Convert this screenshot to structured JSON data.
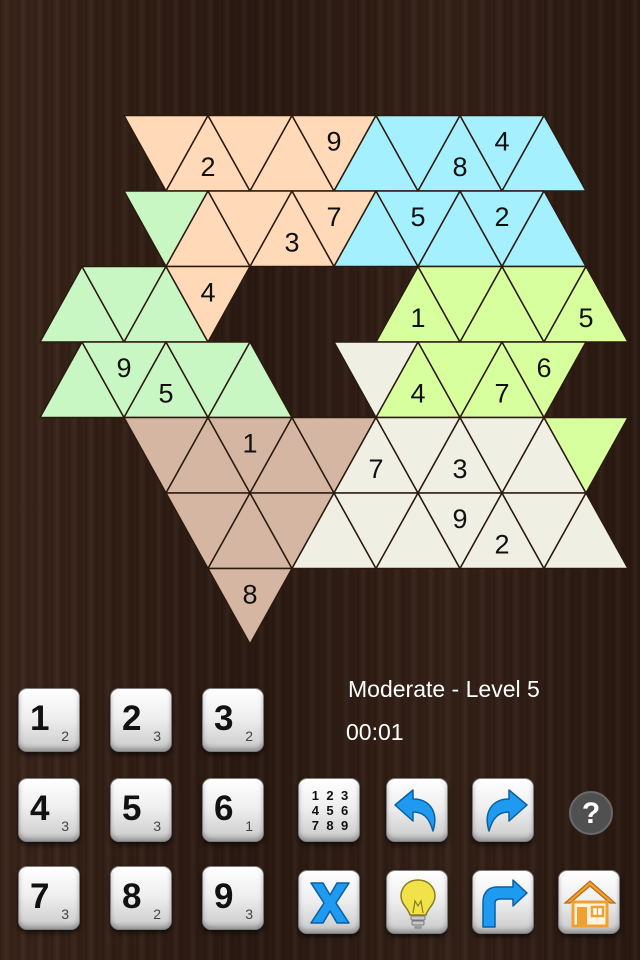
{
  "puzzle": {
    "clues": [
      {
        "row": 1,
        "col": 0,
        "value": "2"
      },
      {
        "row": 1,
        "col": 4,
        "value": "9"
      },
      {
        "row": 1,
        "col": 7,
        "value": "8"
      },
      {
        "row": 1,
        "col": 8,
        "value": "4"
      },
      {
        "row": 2,
        "col": 3,
        "value": "3"
      },
      {
        "row": 2,
        "col": 4,
        "value": "7"
      },
      {
        "row": 2,
        "col": 6,
        "value": "5"
      },
      {
        "row": 2,
        "col": 8,
        "value": "2"
      },
      {
        "row": 3,
        "col": 3,
        "value": "4"
      },
      {
        "row": 3,
        "col": 8,
        "value": "1"
      },
      {
        "row": 3,
        "col": 12,
        "value": "5"
      },
      {
        "row": 4,
        "col": 1,
        "value": "9"
      },
      {
        "row": 4,
        "col": 2,
        "value": "5"
      },
      {
        "row": 4,
        "col": 8,
        "value": "4"
      },
      {
        "row": 4,
        "col": 10,
        "value": "7"
      },
      {
        "row": 4,
        "col": 11,
        "value": "6"
      },
      {
        "row": 5,
        "col": 3,
        "value": "1"
      },
      {
        "row": 5,
        "col": 6,
        "value": "7"
      },
      {
        "row": 5,
        "col": 8,
        "value": "3"
      },
      {
        "row": 6,
        "col": 8,
        "value": "9"
      },
      {
        "row": 6,
        "col": 9,
        "value": "2"
      },
      {
        "row": 7,
        "col": 2,
        "value": "8"
      }
    ],
    "region_colors": {
      "orange": "#ffd9b8",
      "blue": "#a5f0ff",
      "green": "#c9f7c3",
      "lime": "#d8ff9e",
      "brown": "#d4b6a3",
      "cream": "#efefe4"
    },
    "line_color": "#2a1a0e"
  },
  "status": {
    "difficulty": "Moderate - Level 5",
    "timer": "00:01"
  },
  "keypad": [
    {
      "digit": "1",
      "count": "2"
    },
    {
      "digit": "2",
      "count": "3"
    },
    {
      "digit": "3",
      "count": "2"
    },
    {
      "digit": "4",
      "count": "3"
    },
    {
      "digit": "5",
      "count": "3"
    },
    {
      "digit": "6",
      "count": "1"
    },
    {
      "digit": "7",
      "count": "3"
    },
    {
      "digit": "8",
      "count": "2"
    },
    {
      "digit": "9",
      "count": "3"
    }
  ],
  "tools": {
    "candidates_grid": [
      "1",
      "2",
      "3",
      "4",
      "5",
      "6",
      "7",
      "8",
      "9"
    ],
    "icons": [
      "candidates-icon",
      "undo-icon",
      "redo-icon",
      "help-icon",
      "erase-icon",
      "hint-icon",
      "restart-icon",
      "home-icon"
    ],
    "accent_blue": "#1e9bf0",
    "hint_yellow": "#f2e24a",
    "home_orange": "#f0a030",
    "help_gray": "#505050"
  }
}
